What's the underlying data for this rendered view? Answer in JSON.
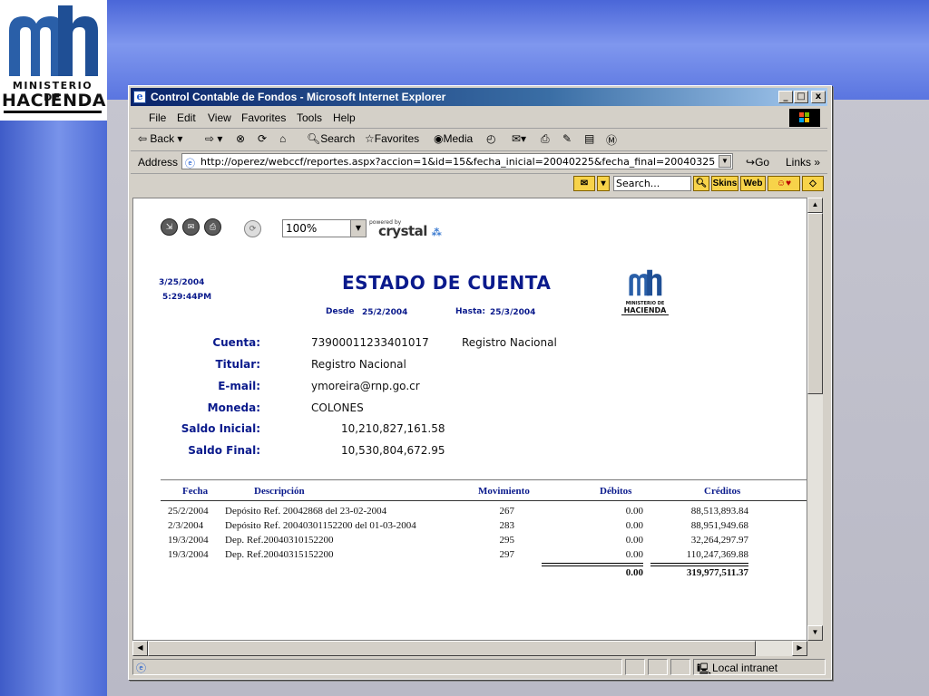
{
  "logo": {
    "line1": "MINISTERIO DE",
    "line2": "HACIENDA"
  },
  "window": {
    "title": "Control Contable de Fondos - Microsoft Internet Explorer",
    "minimize": "_",
    "maximize": "□",
    "close": "x"
  },
  "menu": [
    "File",
    "Edit",
    "View",
    "Favorites",
    "Tools",
    "Help"
  ],
  "toolbar": {
    "back": "Back",
    "search": "Search",
    "favorites": "Favorites",
    "media": "Media"
  },
  "address": {
    "label": "Address",
    "url": "http://operez/webccf/reportes.aspx?accion=1&id=15&fecha_inicial=20040225&fecha_final=20040325",
    "go": "Go",
    "links": "Links"
  },
  "searchbar": {
    "search_placeholder": "Search...",
    "skins": "Skins",
    "web": "Web"
  },
  "report_toolbar": {
    "zoom": "100%",
    "powered_by": "powered by",
    "crystal": "crystal"
  },
  "report": {
    "date": "3/25/2004",
    "time": "5:29:44PM",
    "title": "ESTADO DE CUENTA",
    "desde_label": "Desde",
    "desde_value": "25/2/2004",
    "hasta_label": "Hasta:",
    "hasta_value": "25/3/2004",
    "logo_l1": "MINISTERIO DE",
    "logo_l2": "HACIENDA",
    "fields": [
      {
        "label": "Cuenta:",
        "value": "73900011233401017",
        "extra": "Registro Nacional"
      },
      {
        "label": "Titular:",
        "value": "Registro Nacional"
      },
      {
        "label": "E-mail:",
        "value": "ymoreira@rnp.go.cr"
      },
      {
        "label": "Moneda:",
        "value": "COLONES"
      },
      {
        "label": "Saldo Inicial:",
        "value": "10,210,827,161.58"
      },
      {
        "label": "Saldo Final:",
        "value": "10,530,804,672.95"
      }
    ],
    "table": {
      "headers": [
        "Fecha",
        "Descripción",
        "Movimiento",
        "Débitos",
        "Créditos"
      ],
      "rows": [
        {
          "fecha": "25/2/2004",
          "descripcion": "Depósito Ref. 20042868  del 23-02-2004",
          "movimiento": "267",
          "debitos": "0.00",
          "creditos": "88,513,893.84"
        },
        {
          "fecha": "2/3/2004",
          "descripcion": "Depósito Ref. 20040301152200  del 01-03-2004",
          "movimiento": "283",
          "debitos": "0.00",
          "creditos": "88,951,949.68"
        },
        {
          "fecha": "19/3/2004",
          "descripcion": "Dep. Ref.20040310152200",
          "movimiento": "295",
          "debitos": "0.00",
          "creditos": "32,264,297.97"
        },
        {
          "fecha": "19/3/2004",
          "descripcion": "Dep. Ref.20040315152200",
          "movimiento": "297",
          "debitos": "0.00",
          "creditos": "110,247,369.88"
        }
      ],
      "total_debitos": "0.00",
      "total_creditos": "319,977,511.37"
    }
  },
  "status": {
    "zone": "Local intranet"
  }
}
